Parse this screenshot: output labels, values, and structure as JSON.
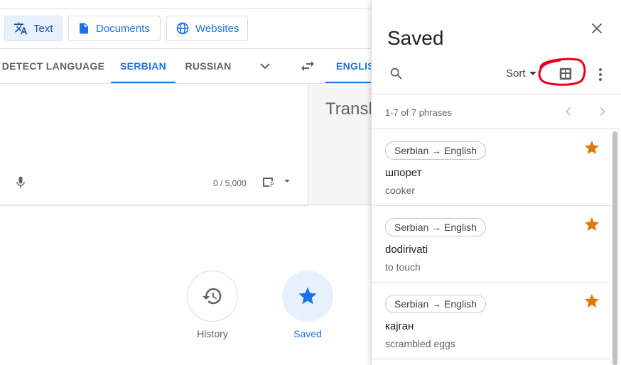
{
  "modes": {
    "text_label": "Text",
    "documents_label": "Documents",
    "websites_label": "Websites"
  },
  "languages": {
    "detect": "DETECT LANGUAGE",
    "source_selected": "SERBIAN",
    "source_other": "RUSSIAN",
    "target_selected": "ENGLIS"
  },
  "source": {
    "char_count": "0 / 5,000"
  },
  "target": {
    "placeholder": "Transl"
  },
  "bottom_buttons": {
    "history_label": "History",
    "saved_label": "Saved"
  },
  "saved_panel": {
    "title": "Saved",
    "sort_label": "Sort",
    "page_info": "1-7 of 7 phrases",
    "items": [
      {
        "lang_pair": "Serbian → English",
        "phrase": "шпорет",
        "translation": "cooker"
      },
      {
        "lang_pair": "Serbian → English",
        "phrase": "dodirivati",
        "translation": "to touch"
      },
      {
        "lang_pair": "Serbian → English",
        "phrase": "кајган",
        "translation": "scrambled eggs"
      }
    ]
  },
  "colors": {
    "accent": "#1a73e8",
    "star": "#e37400",
    "annotation": "#e8001c"
  }
}
